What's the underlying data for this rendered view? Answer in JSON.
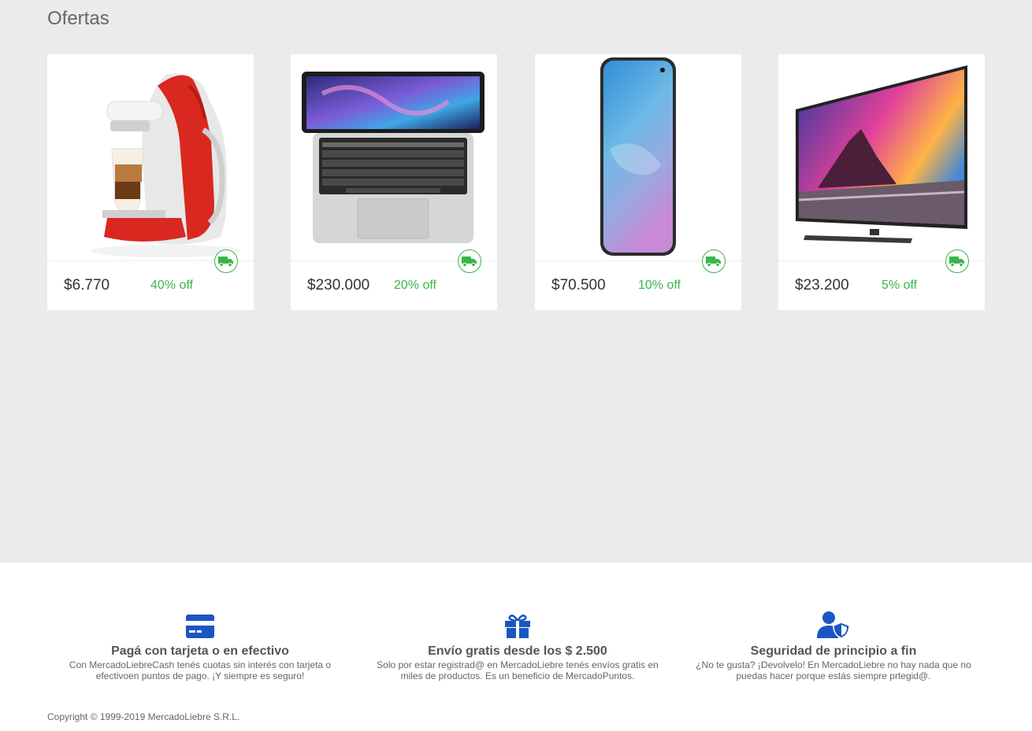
{
  "section_title": "Ofertas",
  "products": [
    {
      "name": "coffee-maker",
      "price": "$6.770",
      "discount": "40% off"
    },
    {
      "name": "laptop",
      "price": "$230.000",
      "discount": "20% off"
    },
    {
      "name": "smartphone",
      "price": "$70.500",
      "discount": "10% off"
    },
    {
      "name": "television",
      "price": "$23.200",
      "discount": "5% off"
    }
  ],
  "features": [
    {
      "icon": "credit-card-icon",
      "title": "Pagá con tarjeta o en efectivo",
      "description": "Con MercadoLiebreCash tenés cuotas sin interés con tarjeta o efectivoen puntos de pago. ¡Y siempre es seguro!"
    },
    {
      "icon": "gift-icon",
      "title": "Envío gratis desde los $ 2.500",
      "description": "Solo por estar registrad@ en MercadoLiebre tenés envíos gratis en miles de productos. Es un beneficio de MercadoPuntos."
    },
    {
      "icon": "user-shield-icon",
      "title": "Seguridad de principio a fin",
      "description": "¿No te gusta? ¡Devolvelo! En MercadoLiebre no hay nada que no puedas hacer porque estás siempre prtegid@."
    }
  ],
  "copyright": "Copyright © 1999-2019 MercadoLiebre S.R.L.",
  "colors": {
    "accent_green": "#39b54a",
    "icon_blue": "#1a56c2",
    "background": "#ebebeb"
  }
}
